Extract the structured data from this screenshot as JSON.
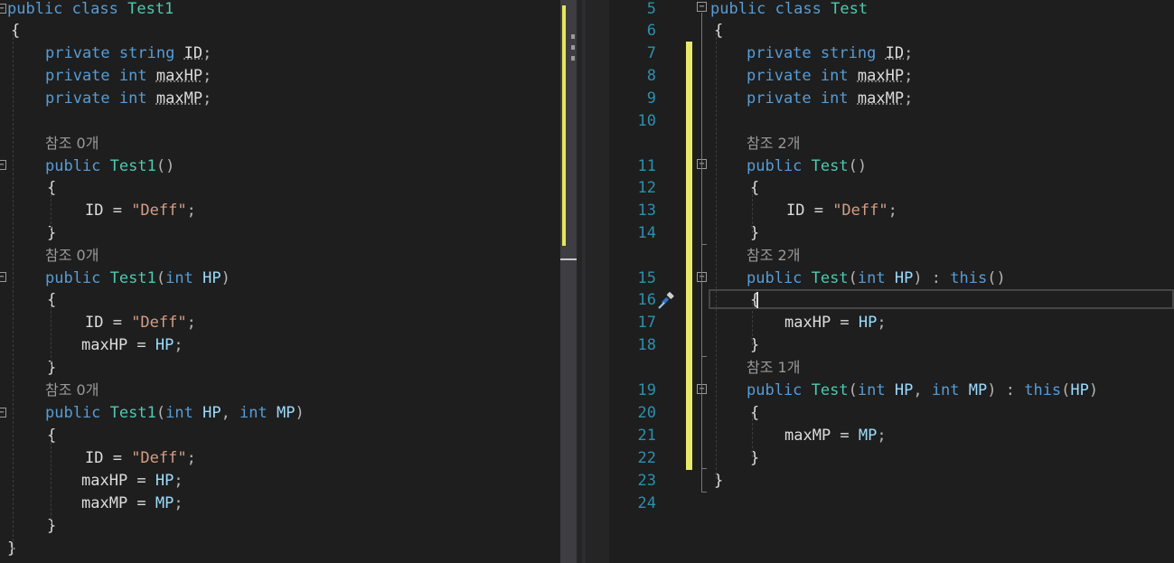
{
  "left_editor": {
    "lines": [
      [
        [
          "kw",
          "public"
        ],
        [
          "id",
          " "
        ],
        [
          "kw",
          "class"
        ],
        [
          "id",
          " "
        ],
        [
          "cls",
          "Test1"
        ]
      ],
      [
        [
          "id",
          "{"
        ]
      ],
      [],
      [
        [
          "kw",
          "private"
        ],
        [
          "id",
          " "
        ],
        [
          "kw",
          "string"
        ],
        [
          "id",
          " "
        ],
        [
          "fld",
          "ID"
        ],
        [
          "punct",
          ";"
        ]
      ],
      [
        [
          "kw",
          "private"
        ],
        [
          "id",
          " "
        ],
        [
          "kw",
          "int"
        ],
        [
          "id",
          " "
        ],
        [
          "fld",
          "maxHP"
        ],
        [
          "punct",
          ";"
        ]
      ],
      [
        [
          "kw",
          "private"
        ],
        [
          "id",
          " "
        ],
        [
          "kw",
          "int"
        ],
        [
          "id",
          " "
        ],
        [
          "fld",
          "maxMP"
        ],
        [
          "punct",
          ";"
        ]
      ],
      [],
      [
        [
          "codelens",
          "참조 0개"
        ]
      ],
      [
        [
          "kw",
          "public"
        ],
        [
          "id",
          " "
        ],
        [
          "cls",
          "Test1"
        ],
        [
          "punct",
          "()"
        ]
      ],
      [
        [
          "id",
          "{"
        ]
      ],
      [
        [
          "id",
          "ID = "
        ],
        [
          "str",
          "\"Deff\""
        ],
        [
          "punct",
          ";"
        ]
      ],
      [
        [
          "id",
          "}"
        ]
      ],
      [
        [
          "codelens",
          "참조 0개"
        ]
      ],
      [
        [
          "kw",
          "public"
        ],
        [
          "id",
          " "
        ],
        [
          "cls",
          "Test1"
        ],
        [
          "punct",
          "("
        ],
        [
          "kw",
          "int"
        ],
        [
          "id",
          " "
        ],
        [
          "param",
          "HP"
        ],
        [
          "punct",
          ")"
        ]
      ],
      [
        [
          "id",
          "{"
        ]
      ],
      [
        [
          "id",
          "ID = "
        ],
        [
          "str",
          "\"Deff\""
        ],
        [
          "punct",
          ";"
        ]
      ],
      [
        [
          "id",
          "maxHP = "
        ],
        [
          "param",
          "HP"
        ],
        [
          "punct",
          ";"
        ]
      ],
      [
        [
          "id",
          "}"
        ]
      ],
      [
        [
          "codelens",
          "참조 0개"
        ]
      ],
      [
        [
          "kw",
          "public"
        ],
        [
          "id",
          " "
        ],
        [
          "cls",
          "Test1"
        ],
        [
          "punct",
          "("
        ],
        [
          "kw",
          "int"
        ],
        [
          "id",
          " "
        ],
        [
          "param",
          "HP"
        ],
        [
          "punct",
          ", "
        ],
        [
          "kw",
          "int"
        ],
        [
          "id",
          " "
        ],
        [
          "param",
          "MP"
        ],
        [
          "punct",
          ")"
        ]
      ],
      [
        [
          "id",
          "{"
        ]
      ],
      [
        [
          "id",
          "ID = "
        ],
        [
          "str",
          "\"Deff\""
        ],
        [
          "punct",
          ";"
        ]
      ],
      [
        [
          "id",
          "maxHP = "
        ],
        [
          "param",
          "HP"
        ],
        [
          "punct",
          ";"
        ]
      ],
      [
        [
          "id",
          "maxMP = "
        ],
        [
          "param",
          "MP"
        ],
        [
          "punct",
          ";"
        ]
      ],
      [
        [
          "id",
          "}"
        ]
      ],
      [
        [
          "id",
          "}"
        ]
      ]
    ]
  },
  "right_editor": {
    "line_numbers": [
      "5",
      "6",
      "7",
      "8",
      "9",
      "10",
      "11",
      "12",
      "13",
      "14",
      "15",
      "16",
      "17",
      "18",
      "19",
      "20",
      "21",
      "22",
      "23",
      "24"
    ],
    "lines": [
      [
        [
          "kw",
          "public"
        ],
        [
          "id",
          " "
        ],
        [
          "kw",
          "class"
        ],
        [
          "id",
          " "
        ],
        [
          "cls",
          "Test"
        ]
      ],
      [
        [
          "id",
          "{"
        ]
      ],
      [
        [
          "kw",
          "private"
        ],
        [
          "id",
          " "
        ],
        [
          "kw",
          "string"
        ],
        [
          "id",
          " "
        ],
        [
          "fld",
          "ID"
        ],
        [
          "punct",
          ";"
        ]
      ],
      [
        [
          "kw",
          "private"
        ],
        [
          "id",
          " "
        ],
        [
          "kw",
          "int"
        ],
        [
          "id",
          " "
        ],
        [
          "fld",
          "maxHP"
        ],
        [
          "punct",
          ";"
        ]
      ],
      [
        [
          "kw",
          "private"
        ],
        [
          "id",
          " "
        ],
        [
          "kw",
          "int"
        ],
        [
          "id",
          " "
        ],
        [
          "fld",
          "maxMP"
        ],
        [
          "punct",
          ";"
        ]
      ],
      [],
      [
        [
          "codelens",
          "참조 2개"
        ]
      ],
      [
        [
          "kw",
          "public"
        ],
        [
          "id",
          " "
        ],
        [
          "cls",
          "Test"
        ],
        [
          "punct",
          "()"
        ]
      ],
      [
        [
          "id",
          "{"
        ]
      ],
      [
        [
          "id",
          "ID = "
        ],
        [
          "str",
          "\"Deff\""
        ],
        [
          "punct",
          ";"
        ]
      ],
      [
        [
          "id",
          "}"
        ]
      ],
      [
        [
          "codelens",
          "참조 2개"
        ]
      ],
      [
        [
          "kw",
          "public"
        ],
        [
          "id",
          " "
        ],
        [
          "cls",
          "Test"
        ],
        [
          "punct",
          "("
        ],
        [
          "kw",
          "int"
        ],
        [
          "id",
          " "
        ],
        [
          "param",
          "HP"
        ],
        [
          "punct",
          ") : "
        ],
        [
          "kw",
          "this"
        ],
        [
          "punct",
          "()"
        ]
      ],
      [
        [
          "id",
          "{"
        ]
      ],
      [
        [
          "id",
          "maxHP = "
        ],
        [
          "param",
          "HP"
        ],
        [
          "punct",
          ";"
        ]
      ],
      [
        [
          "id",
          "}"
        ]
      ],
      [
        [
          "codelens",
          "참조 1개"
        ]
      ],
      [
        [
          "kw",
          "public"
        ],
        [
          "id",
          " "
        ],
        [
          "cls",
          "Test"
        ],
        [
          "punct",
          "("
        ],
        [
          "kw",
          "int"
        ],
        [
          "id",
          " "
        ],
        [
          "param",
          "HP"
        ],
        [
          "punct",
          ", "
        ],
        [
          "kw",
          "int"
        ],
        [
          "id",
          " "
        ],
        [
          "param",
          "MP"
        ],
        [
          "punct",
          ") : "
        ],
        [
          "kw",
          "this"
        ],
        [
          "punct",
          "("
        ],
        [
          "param",
          "HP"
        ],
        [
          "punct",
          ")"
        ]
      ],
      [
        [
          "id",
          "{"
        ]
      ],
      [
        [
          "id",
          "maxMP = "
        ],
        [
          "param",
          "MP"
        ],
        [
          "punct",
          ";"
        ]
      ],
      [
        [
          "id",
          "}"
        ]
      ],
      [
        [
          "id",
          "}"
        ]
      ]
    ]
  },
  "icons": {
    "quick_action": "screwdriver-icon"
  }
}
